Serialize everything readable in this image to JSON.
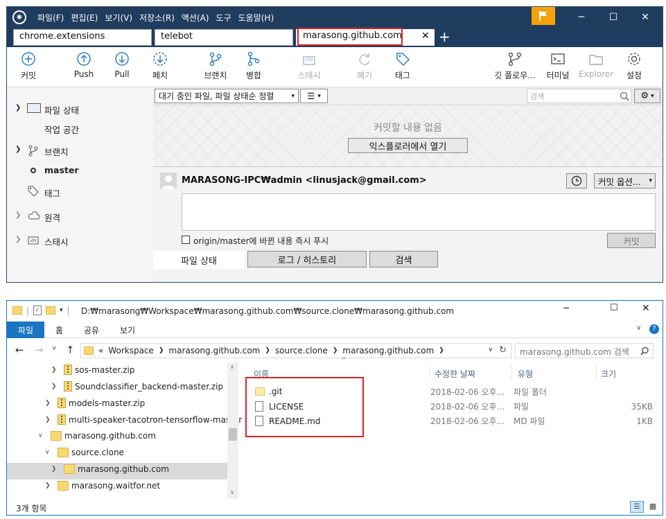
{
  "sourcetree": {
    "menu": [
      "파일(F)",
      "편집(E)",
      "보기(V)",
      "저장소(R)",
      "액션(A)",
      "도구",
      "도움말(H)"
    ],
    "tabs": [
      "chrome.extensions",
      "telebot",
      "marasong.github.com"
    ],
    "toolbar": {
      "commit": "커밋",
      "push": "Push",
      "pull": "Pull",
      "fetch": "페치",
      "branch": "브랜치",
      "merge": "병합",
      "stash": "스태시",
      "discard": "폐기",
      "tag": "태그",
      "gitflow": "깃 플로우...",
      "terminal": "터미널",
      "explorer": "Explorer",
      "settings": "설정"
    },
    "sidebar": {
      "file_status": "파일 상태",
      "workspace": "작업 공간",
      "branches": "브랜치",
      "master": "master",
      "tags": "태그",
      "remotes": "원격",
      "stashes": "스태시"
    },
    "filter": {
      "sort": "대기 중인 파일, 파일 상태순 정렬",
      "search_placeholder": "검색"
    },
    "empty_message": "커밋할 내용 없음",
    "open_explorer": "익스플로러에서 열기",
    "author": "MARASONG-IPC₩admin <linusjack@gmail.com>",
    "commit_options": "커밋 옵션...",
    "push_checkbox": "origin/master에 바뀐 내용 즉시 푸시",
    "commit_button": "커밋",
    "bottom_tabs": [
      "파일 상태",
      "로그 / 히스토리",
      "검색"
    ]
  },
  "explorer": {
    "title_path": "D:₩marasong₩Workspace₩marasong.github.com₩source.clone₩marasong.github.com",
    "ribbon": [
      "파일",
      "홈",
      "공유",
      "보기"
    ],
    "breadcrumb": [
      "«",
      "Workspace",
      "marasong.github.com",
      "source.clone",
      "marasong.github.com"
    ],
    "search_placeholder": "marasong.github.com 검색",
    "tree": [
      {
        "label": "sos-master.zip",
        "type": "zip"
      },
      {
        "label": "Soundclassifier_backend-master.zip",
        "type": "zip"
      },
      {
        "label": "models-master.zip",
        "type": "zip"
      },
      {
        "label": "multi-speaker-tacotron-tensorflow-master",
        "type": "zip"
      },
      {
        "label": "marasong.github.com",
        "type": "folder"
      },
      {
        "label": "source.clone",
        "type": "folder"
      },
      {
        "label": "marasong.github.com",
        "type": "folder"
      },
      {
        "label": "marasong.waitfor.net",
        "type": "folder"
      }
    ],
    "columns": [
      "이름",
      "수정한 날짜",
      "유형",
      "크기"
    ],
    "files": [
      {
        "name": ".git",
        "date": "2018-02-06 오후...",
        "type": "파일 폴더",
        "size": ""
      },
      {
        "name": "LICENSE",
        "date": "2018-02-06 오후...",
        "type": "파일",
        "size": "35KB"
      },
      {
        "name": "README.md",
        "date": "2018-02-06 오후...",
        "type": "MD 파일",
        "size": "1KB"
      }
    ],
    "status": "3개 항목"
  },
  "colors": {
    "titlebar": "#1f3d5f",
    "flag": "#f6a10a",
    "highlight": "#e02020",
    "ribbon_file": "#1a75c2"
  }
}
